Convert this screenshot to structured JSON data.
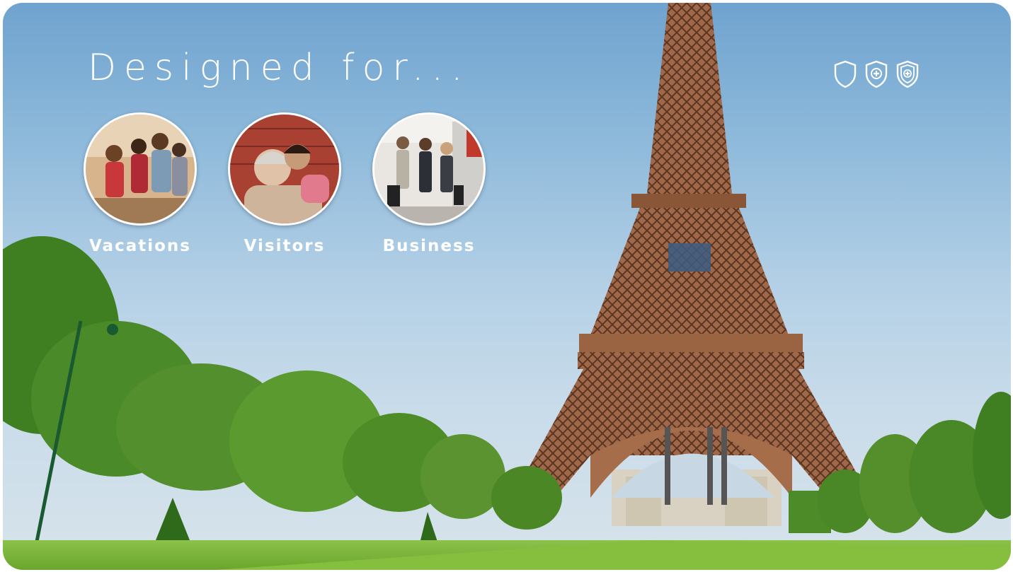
{
  "hero": {
    "title": "Designed for...",
    "background_scene": "eiffel-tower-champ-de-mars",
    "shield_icons": [
      "shield-outline-icon",
      "shield-plus-icon",
      "shield-plus-double-icon"
    ]
  },
  "categories": [
    {
      "label": "Vacations",
      "photo": "group-of-friends"
    },
    {
      "label": "Visitors",
      "photo": "grandmother-and-granddaughter"
    },
    {
      "label": "Business",
      "photo": "business-travelers-with-luggage"
    }
  ],
  "colors": {
    "text": "#ffffff",
    "sky_top": "#6fa3cf",
    "sky_bottom": "#d7e3ea",
    "tower": "#a5704a",
    "grass": "#7fb83a"
  }
}
